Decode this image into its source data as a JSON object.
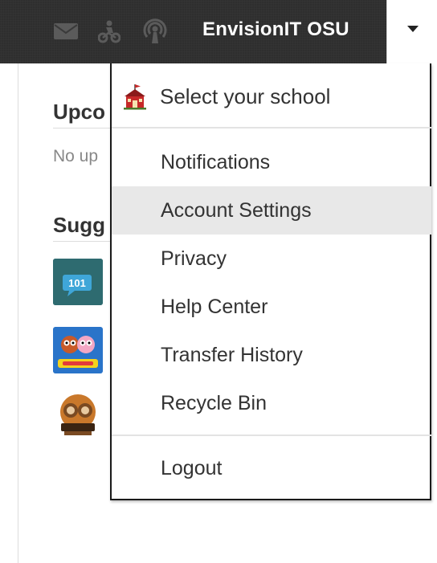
{
  "topbar": {
    "user_name": "EnvisionIT OSU",
    "icons": [
      "mail-icon",
      "bicycle-icon",
      "broadcast-icon"
    ],
    "dropdown_toggle": "chevron-down-icon"
  },
  "page": {
    "upcoming_title": "Upco",
    "upcoming_empty": "No up",
    "suggested_title": "Sugg",
    "suggested_apps": [
      {
        "icon": "app-101-icon",
        "label": "101"
      },
      {
        "icon": "app-cartoon-icon",
        "label": ""
      },
      {
        "icon": "app-characters-icon",
        "label": ""
      }
    ]
  },
  "menu": {
    "school": {
      "label": "Select your school",
      "icon": "schoolhouse-icon"
    },
    "items": [
      {
        "label": "Notifications"
      },
      {
        "label": "Account Settings",
        "highlighted": true
      },
      {
        "label": "Privacy"
      },
      {
        "label": "Help Center"
      },
      {
        "label": "Transfer History"
      },
      {
        "label": "Recycle Bin"
      }
    ],
    "logout": {
      "label": "Logout"
    }
  },
  "colors": {
    "topbar_bg": "#2e2e2e",
    "highlight_bg": "#e8e8e8",
    "text": "#333333",
    "menu_border": "#1a1a1a"
  }
}
